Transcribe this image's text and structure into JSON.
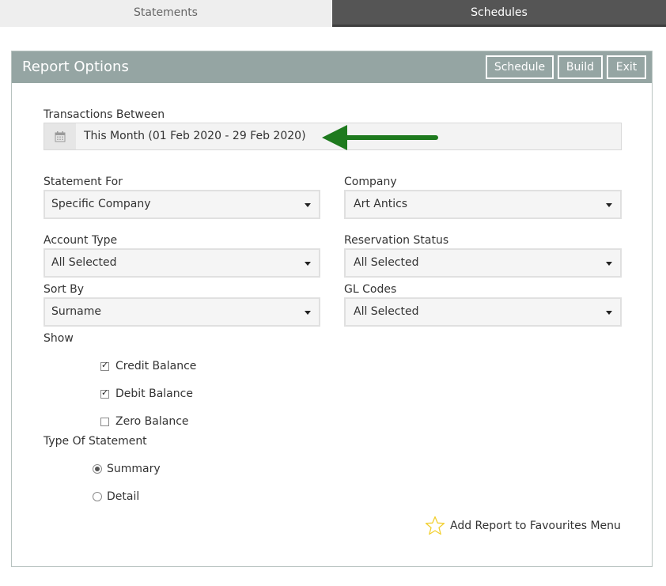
{
  "tabs": {
    "statements": "Statements",
    "schedules": "Schedules"
  },
  "panel": {
    "title": "Report Options",
    "buttons": {
      "schedule": "Schedule",
      "build": "Build",
      "exit": "Exit"
    }
  },
  "transactions": {
    "label": "Transactions Between",
    "value": "This Month (01 Feb 2020 - 29 Feb 2020)",
    "icon": "calendar-icon"
  },
  "statement_for": {
    "label": "Statement For",
    "value": "Specific Company"
  },
  "company": {
    "label": "Company",
    "value": "Art Antics"
  },
  "account_type": {
    "label": "Account Type",
    "value": "All Selected"
  },
  "reservation_status": {
    "label": "Reservation Status",
    "value": "All Selected"
  },
  "sort_by": {
    "label": "Sort By",
    "value": "Surname"
  },
  "gl_codes": {
    "label": "GL Codes",
    "value": "All Selected"
  },
  "show": {
    "label": "Show",
    "options": [
      {
        "label": "Credit Balance",
        "checked": true
      },
      {
        "label": "Debit Balance",
        "checked": true
      },
      {
        "label": "Zero Balance",
        "checked": false
      }
    ]
  },
  "statement_type": {
    "label": "Type Of Statement",
    "options": [
      {
        "label": "Summary",
        "selected": true
      },
      {
        "label": "Detail",
        "selected": false
      }
    ]
  },
  "favourites": {
    "label": "Add Report to Favourites Menu",
    "icon": "star-icon"
  },
  "colors": {
    "header": "#95a5a3",
    "arrow": "#1e7a1e",
    "star": "#f2cf2f"
  }
}
